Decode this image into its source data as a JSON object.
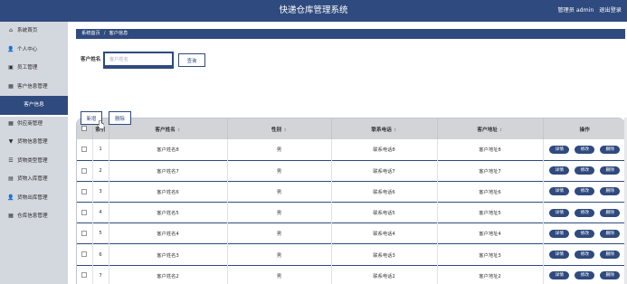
{
  "header": {
    "title": "快递仓库管理系统",
    "user_label": "管理员 admin",
    "logout_label": "退出登录"
  },
  "sidebar": {
    "items": [
      {
        "icon": "home-icon",
        "glyph": "⌂",
        "label": "系统首页"
      },
      {
        "icon": "user-icon",
        "glyph": "👤",
        "label": "个人中心"
      },
      {
        "icon": "staff-icon",
        "glyph": "▣",
        "label": "员工管理"
      },
      {
        "icon": "grid-icon",
        "glyph": "▦",
        "label": "客户信息管理"
      },
      {
        "icon": "",
        "glyph": "",
        "label": "客户信息",
        "active": true,
        "sub": true
      },
      {
        "icon": "supplier-icon",
        "glyph": "▦",
        "label": "供应商管理"
      },
      {
        "icon": "goods-icon",
        "glyph": "▼",
        "label": "货物信息管理"
      },
      {
        "icon": "list-icon",
        "glyph": "☰",
        "label": "货物类型管理"
      },
      {
        "icon": "inbound-icon",
        "glyph": "▤",
        "label": "货物入库管理"
      },
      {
        "icon": "outbound-icon",
        "glyph": "👤",
        "label": "货物出库管理"
      },
      {
        "icon": "warehouse-icon",
        "glyph": "▦",
        "label": "仓库信息管理"
      }
    ]
  },
  "breadcrumb": {
    "home": "系统首页",
    "separator": "/",
    "current": "客户信息"
  },
  "search": {
    "label": "客户姓名",
    "placeholder": "客户姓名",
    "value": "",
    "query_label": "查询"
  },
  "actions": {
    "add_label": "新增",
    "delete_label": "删除"
  },
  "table": {
    "columns": [
      "索引",
      "客户姓名",
      "性别",
      "联系电话",
      "客户地址",
      "操作"
    ],
    "sort_glyph": "↕",
    "row_actions": [
      "详情",
      "修改",
      "删除"
    ],
    "rows": [
      {
        "index": "1",
        "name": "客户姓名8",
        "gender": "男",
        "phone": "联系电话8",
        "address": "客户地址8"
      },
      {
        "index": "2",
        "name": "客户姓名7",
        "gender": "男",
        "phone": "联系电话7",
        "address": "客户地址7"
      },
      {
        "index": "3",
        "name": "客户姓名6",
        "gender": "男",
        "phone": "联系电话6",
        "address": "客户地址6"
      },
      {
        "index": "4",
        "name": "客户姓名5",
        "gender": "男",
        "phone": "联系电话5",
        "address": "客户地址5"
      },
      {
        "index": "5",
        "name": "客户姓名4",
        "gender": "男",
        "phone": "联系电话4",
        "address": "客户地址4"
      },
      {
        "index": "6",
        "name": "客户姓名3",
        "gender": "男",
        "phone": "联系电话3",
        "address": "客户地址3"
      },
      {
        "index": "7",
        "name": "客户姓名2",
        "gender": "男",
        "phone": "联系电话2",
        "address": "客户地址2"
      }
    ]
  },
  "colors": {
    "primary": "#2f4a7e",
    "sidebar_bg": "#d3d7de",
    "header_row_bg": "#d2d4d8"
  }
}
